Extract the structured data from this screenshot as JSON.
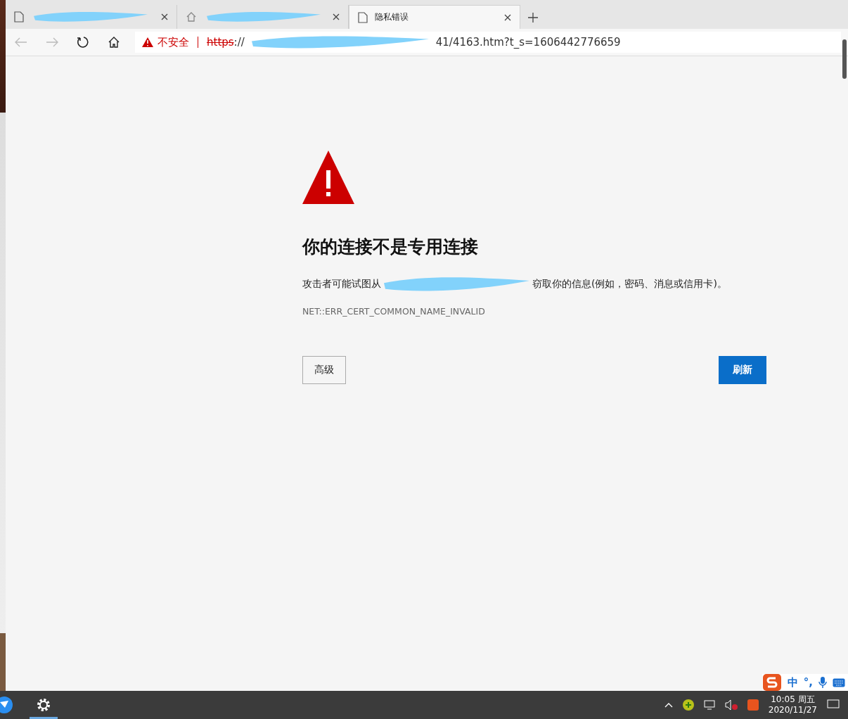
{
  "tabs": [
    {
      "kind": "page",
      "selected": false
    },
    {
      "kind": "home",
      "selected": false
    },
    {
      "kind": "page",
      "title": "隐私错误",
      "selected": true
    }
  ],
  "address_bar": {
    "security_label": "不安全",
    "scheme": "https",
    "scheme_sep": "://",
    "url_tail": "41/4163.htm?t_s=1606442776659"
  },
  "page": {
    "heading": "你的连接不是专用连接",
    "description_before": "攻击者可能试图从",
    "description_after": "窃取你的信息(例如，密码、消息或信用卡)。",
    "error_code": "NET::ERR_CERT_COMMON_NAME_INVALID",
    "buttons": [
      {
        "label": "高级",
        "kind": "secondary"
      },
      {
        "label": "刷新",
        "kind": "primary"
      }
    ]
  },
  "ime": {
    "mode": "中",
    "punctuation": "°,"
  },
  "taskbar": {
    "time": "10:05 周五",
    "date": "2020/11/27"
  }
}
